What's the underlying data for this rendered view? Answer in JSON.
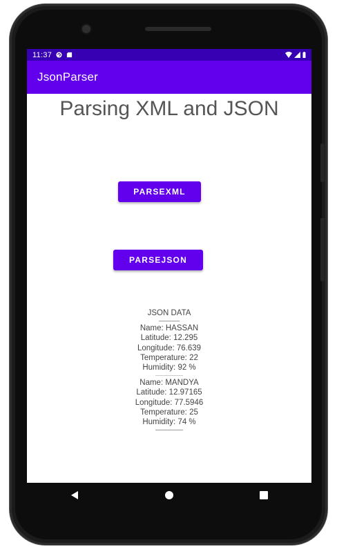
{
  "status_bar": {
    "time": "11:37",
    "icons": [
      "sync-icon",
      "sd-card-icon",
      "wifi-icon",
      "signal-icon",
      "battery-icon"
    ]
  },
  "app_bar": {
    "title": "JsonParser"
  },
  "main": {
    "heading": "Parsing XML and JSON",
    "parse_xml_button": "PARSEXML",
    "parse_json_button": "PARSEJSON"
  },
  "output": {
    "header": "JSON DATA",
    "entries": [
      {
        "name": "Name: HASSAN",
        "latitude": "Latitude: 12.295",
        "longitude": "Longitude: 76.639",
        "temperature": "Temperature: 22",
        "humidity": "Humidity: 92 %"
      },
      {
        "name": "Name: MANDYA",
        "latitude": "Latitude: 12.97165",
        "longitude": "Longitude: 77.5946",
        "temperature": "Temperature: 25",
        "humidity": "Humidity: 74 %"
      }
    ]
  },
  "nav_bar": {
    "buttons": [
      "back-icon",
      "home-icon",
      "recents-icon"
    ]
  },
  "colors": {
    "status_bar": "#3700b3",
    "app_bar": "#6200ee",
    "button": "#6200ee"
  }
}
